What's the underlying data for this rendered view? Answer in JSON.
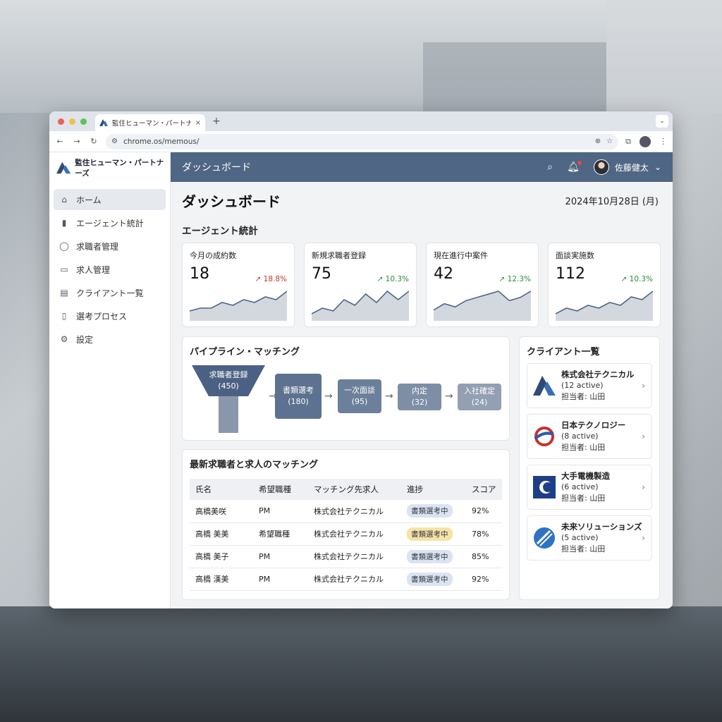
{
  "browser": {
    "tab_title": "監住ヒューマン・パートナーズ",
    "tab_close": "×",
    "new_tab": "+",
    "url": "chrome.os/memous/"
  },
  "brand": {
    "name": "監住ヒューマン・パートナーズ"
  },
  "sidebar": {
    "items": [
      {
        "label": "ホーム",
        "icon": "home-icon",
        "active": true
      },
      {
        "label": "エージェント統計",
        "icon": "bar-chart-icon"
      },
      {
        "label": "求職者管理",
        "icon": "person-icon"
      },
      {
        "label": "求人管理",
        "icon": "briefcase-icon"
      },
      {
        "label": "クライアント一覧",
        "icon": "building-icon"
      },
      {
        "label": "選考プロセス",
        "icon": "document-icon"
      },
      {
        "label": "設定",
        "icon": "gear-icon"
      }
    ]
  },
  "header": {
    "title": "ダッシュボード",
    "user_name": "佐藤健太"
  },
  "page": {
    "title": "ダッシュボード",
    "date": "2024年10月28日 (月)",
    "stats_title": "エージェント統計"
  },
  "stats": [
    {
      "label": "今月の成約数",
      "value": "18",
      "delta": "↗ 18.8%",
      "delta_color": "#c0392b"
    },
    {
      "label": "新規求職者登録",
      "value": "75",
      "delta": "↗ 10.3%",
      "delta_color": "#2e8b3e"
    },
    {
      "label": "現在進行中案件",
      "value": "42",
      "delta": "↗ 12.3%",
      "delta_color": "#2e8b3e"
    },
    {
      "label": "面談実施数",
      "value": "112",
      "delta": "↗ 10.3%",
      "delta_color": "#2e8b3e"
    }
  ],
  "pipeline": {
    "title": "パイプライン・マッチング",
    "stages": [
      {
        "label": "求職者登録",
        "count": "(450)"
      },
      {
        "label": "書類選考",
        "count": "(180)"
      },
      {
        "label": "一次面談",
        "count": "(95)"
      },
      {
        "label": "内定",
        "count": "(32)"
      },
      {
        "label": "入社確定",
        "count": "(24)"
      }
    ]
  },
  "matching": {
    "title": "最新求職者と求人のマッチング",
    "columns": [
      "氏名",
      "希望職種",
      "マッチング先求人",
      "進捗",
      "スコア"
    ],
    "rows": [
      {
        "name": "高橋美咲",
        "role": "PM",
        "job": "株式会社テクニカル",
        "status": "書類選考中",
        "status_style": "blue",
        "score": "92%"
      },
      {
        "name": "高橋 美美",
        "role": "希望職種",
        "job": "株式会社テクニカル",
        "status": "書類選考中",
        "status_style": "yellow",
        "score": "78%"
      },
      {
        "name": "高橋 美子",
        "role": "PM",
        "job": "株式会社テクニカル",
        "status": "書類選考中",
        "status_style": "blue",
        "score": "85%"
      },
      {
        "name": "高橋 漢美",
        "role": "PM",
        "job": "株式会社テクニカル",
        "status": "書類選考中",
        "status_style": "blue",
        "score": "92%"
      }
    ]
  },
  "clients": {
    "title": "クライアント一覧",
    "items": [
      {
        "name": "株式会社テクニカル",
        "active": "(12 active)",
        "owner": "担当者: 山田"
      },
      {
        "name": "日本テクノロジー",
        "active": "(8 active)",
        "owner": "担当者: 山田"
      },
      {
        "name": "大手電機製造",
        "active": "(6 active)",
        "owner": "担当者: 山田"
      },
      {
        "name": "未来ソリューションズ",
        "active": "(5 active)",
        "owner": "担当者: 山田"
      }
    ]
  },
  "sparklines": [
    [
      3,
      4,
      4,
      6,
      5,
      7,
      6,
      8,
      7,
      10
    ],
    [
      2,
      4,
      3,
      7,
      5,
      9,
      6,
      10,
      7,
      10
    ],
    [
      3,
      5,
      4,
      6,
      7,
      8,
      9,
      6,
      7,
      9
    ],
    [
      2,
      4,
      3,
      5,
      4,
      6,
      5,
      8,
      7,
      10
    ]
  ]
}
